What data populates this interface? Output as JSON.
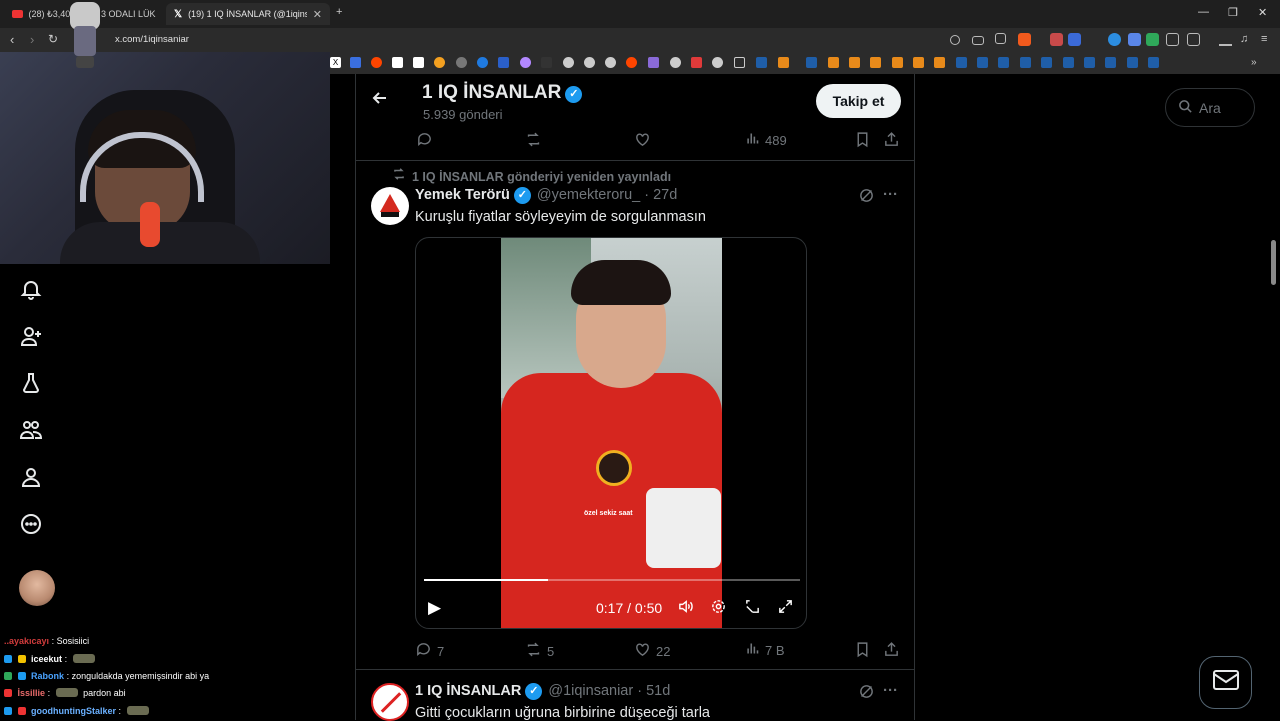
{
  "browser": {
    "tabs": [
      {
        "label": "(28) ₺3,400 ... XL 3 ODALI LÜKS",
        "active": false
      },
      {
        "label": "(19) 1 IQ İNSANLAR (@1iqinsan...",
        "active": true
      }
    ],
    "new_tab": "+",
    "url": "x.com/1iqinsaniar",
    "window_controls": [
      "—",
      "❐",
      "✕"
    ]
  },
  "profile": {
    "name": "1 IQ İNSANLAR",
    "verified_mark": "✓",
    "post_count": "5.939 gönderi",
    "follow_label": "Takip et"
  },
  "top_tweet_actions": {
    "views": "489"
  },
  "repost_notice": "1 IQ İNSANLAR gönderiyi yeniden yayınladı",
  "tweet1": {
    "name": "Yemek Terörü",
    "handle": "@yemekteroru_ · 27d",
    "text": "Kuruşlu fiyatlar söyleyeyim de sorgulanmasın",
    "video": {
      "subtitle": "özel sekiz saat",
      "time": "0:17 / 0:50",
      "progress": 0.33
    },
    "replies": "7",
    "reposts": "5",
    "likes": "22",
    "views": "7 B"
  },
  "tweet2": {
    "name": "1 IQ İNSANLAR",
    "handle": "@1iqinsaniar · 51d",
    "text": "Gitti çocukların uğruna birbirine düşeceği tarla"
  },
  "search": {
    "placeholder": "Ara"
  },
  "chat": [
    {
      "user": "..ayakıcayı",
      "msg": ": Sosisiici",
      "color": "#d13c3c",
      "emote": false
    },
    {
      "user": "iceekut",
      "msg": ":",
      "color": "#ffffff",
      "emote": true
    },
    {
      "user": "Rabonk",
      "msg": ": zonguldakda yememişsindir abi ya",
      "color": "#4aa3ff",
      "emote": false
    },
    {
      "user": "İssillie",
      "msg": ":",
      "color": "#e86a6a",
      "emote": true,
      "after": "pardon abi"
    },
    {
      "user": "goodhuntingStalker",
      "msg": ":",
      "color": "#6ab0ff",
      "emote": true
    }
  ],
  "colors": {
    "accent": "#1d9bf0",
    "border": "#2f3336",
    "muted": "#71767b"
  }
}
